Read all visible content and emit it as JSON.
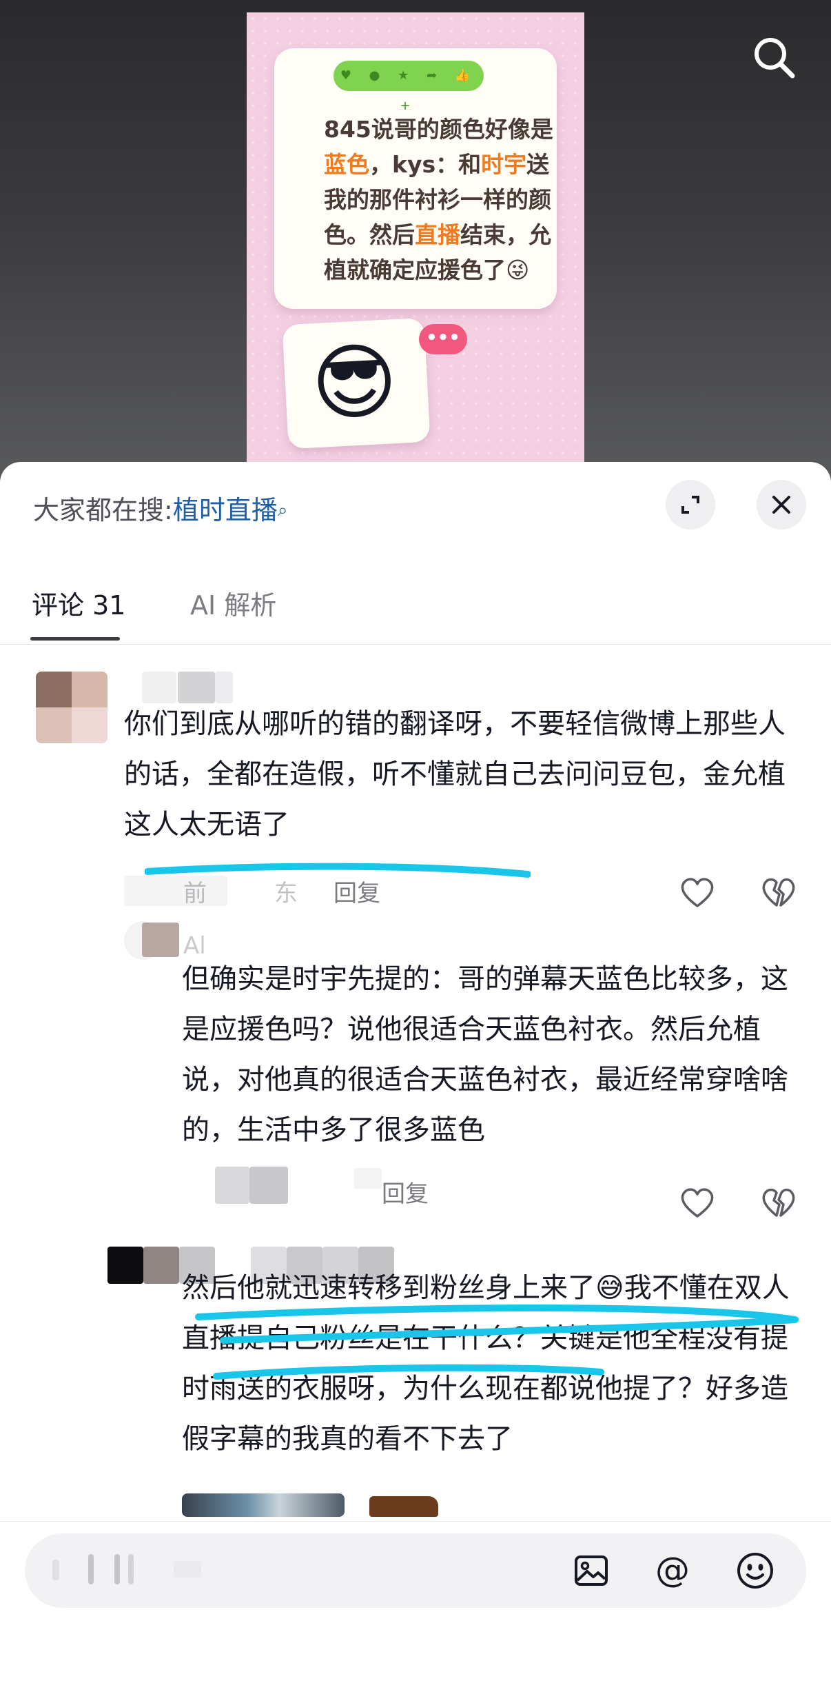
{
  "video": {
    "bubble_text_parts": [
      {
        "text": "845说哥的颜色好像是",
        "hl": false
      },
      {
        "text": "蓝色",
        "hl": true
      },
      {
        "text": "，kys：和",
        "hl": false
      },
      {
        "text": "时宇",
        "hl": true
      },
      {
        "text": "送我的那件衬衫一样的颜色。然后",
        "hl": false
      },
      {
        "text": "直播",
        "hl": true
      },
      {
        "text": "结束，允植就确定应援色了😜",
        "hl": false
      }
    ],
    "emoji": "😎",
    "bubble_dots": "•••",
    "icons": {
      "search": "search-icon"
    },
    "colors": {
      "card_bg": "#f4cfe2",
      "highlight": "#f07a1d",
      "bar_green": "#7fd34f"
    }
  },
  "sheet": {
    "hot_search_prefix": "大家都在搜:",
    "hot_search_keyword": "植时直播",
    "hot_search_mag": "⌕",
    "tabs": [
      {
        "label": "评论 31",
        "active": true
      },
      {
        "label": "AI 解析",
        "active": false
      }
    ],
    "icons": {
      "expand": "expand-icon",
      "close": "close-icon"
    }
  },
  "comments": [
    {
      "text": "你们到底从哪听的错的翻译呀，不要轻信微博上那些人的话，全都在造假，听不懂就自己去问问豆包，金允植这人太无语了",
      "meta_blurred_1": "前",
      "meta_blurred_2": "东",
      "reply_label": "回复"
    },
    {
      "name_blurred": "Al",
      "text": "但确实是时宇先提的：哥的弹幕天蓝色比较多，这是应援色吗？说他很适合天蓝色衬衣。然后允植说，对他真的很适合天蓝色衬衣，最近经常穿啥啥的，生活中多了很多蓝色",
      "reply_label": "回复"
    },
    {
      "text_before_emoji": "然后他就迅速转移到粉丝身上来了",
      "emoji": "😅",
      "text_after_emoji": "我不懂在双人直播提自己粉丝是在干什么？关键是他全程没有提时雨送的衣服呀，为什么现在都说他提了？好多造假字幕的我真的看不下去了"
    }
  ],
  "input": {
    "icons": [
      "image-icon",
      "at-icon",
      "emoji-icon"
    ],
    "at_symbol": "@"
  },
  "colors": {
    "annotation_cyan": "#19c6ea",
    "link_blue": "#1f5fa6"
  }
}
